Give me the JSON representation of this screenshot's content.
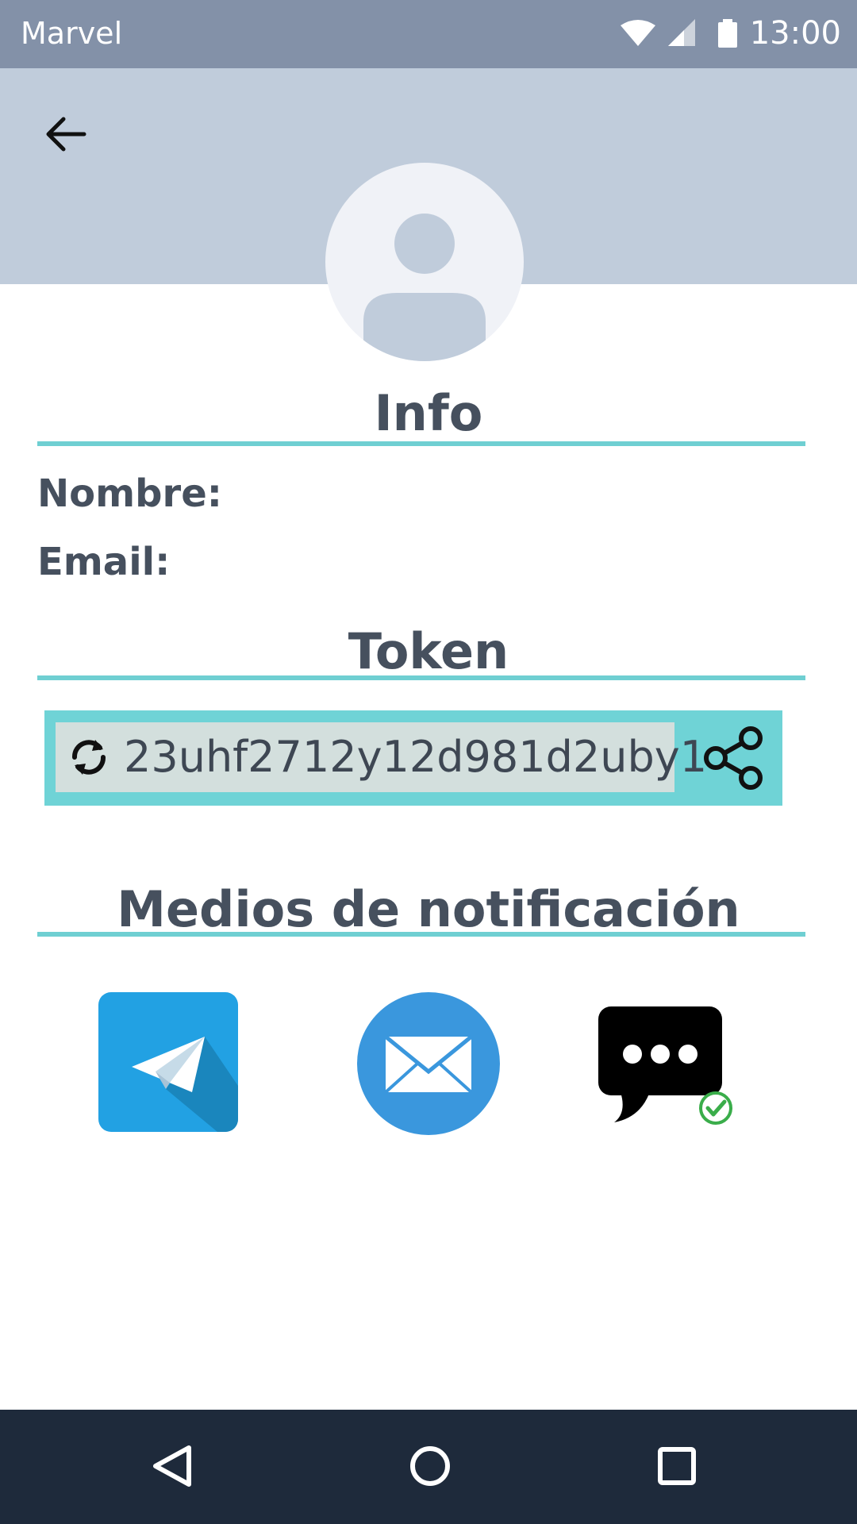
{
  "status_bar": {
    "app_name": "Marvel",
    "time": "13:00",
    "icons": [
      "wifi-icon",
      "signal-icon",
      "battery-icon"
    ]
  },
  "header": {
    "back_icon": "arrow-left-icon",
    "avatar_icon": "user-avatar-placeholder"
  },
  "info": {
    "title": "Info",
    "name_label": "Nombre:",
    "email_label": "Email:"
  },
  "token": {
    "title": "Token",
    "value": "23uhf2712y12d981d2uby1",
    "refresh_icon": "refresh-icon",
    "share_icon": "share-icon"
  },
  "notifications": {
    "title": "Medios de notificación",
    "methods": [
      {
        "name": "telegram",
        "icon": "telegram-icon"
      },
      {
        "name": "email",
        "icon": "mail-icon"
      },
      {
        "name": "sms",
        "icon": "chat-bubble-icon",
        "active": true
      }
    ]
  },
  "nav": {
    "icons": [
      "back-triangle-icon",
      "home-circle-icon",
      "recents-square-icon"
    ]
  },
  "colors": {
    "status_bar": "#8391a8",
    "header": "#c0ccdb",
    "accent": "#6fcfd2",
    "text": "#46505e",
    "nav_bar": "#1e2a3b",
    "telegram": "#22a1e3",
    "mail": "#3a97dd",
    "check": "#3aad4a"
  }
}
